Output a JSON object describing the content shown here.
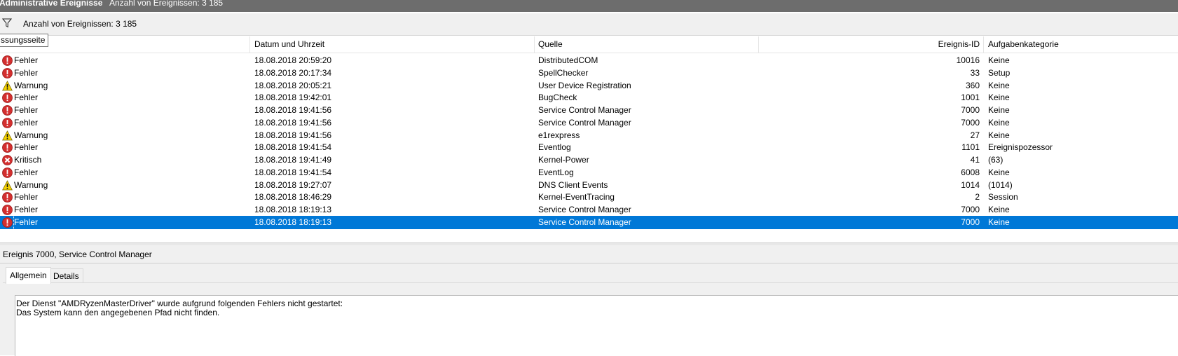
{
  "window": {
    "title": "Administrative Ereignisse",
    "count_text": "Anzahl von Ereignissen: 3 185"
  },
  "filterbar": {
    "icon": "filter-icon",
    "text": "Anzahl von Ereignissen: 3 185"
  },
  "tooltip": "ssungsseite",
  "columns": {
    "datetime": "Datum und Uhrzeit",
    "source": "Quelle",
    "event_id": "Ereignis-ID",
    "category": "Aufgabenkategorie"
  },
  "events": [
    {
      "level": "Fehler",
      "icon": "error-icon",
      "datetime": "18.08.2018 20:59:20",
      "source": "DistributedCOM",
      "id": "10016",
      "category": "Keine"
    },
    {
      "level": "Fehler",
      "icon": "error-icon",
      "datetime": "18.08.2018 20:17:34",
      "source": "SpellChecker",
      "id": "33",
      "category": "Setup"
    },
    {
      "level": "Warnung",
      "icon": "warning-icon",
      "datetime": "18.08.2018 20:05:21",
      "source": "User Device Registration",
      "id": "360",
      "category": "Keine"
    },
    {
      "level": "Fehler",
      "icon": "error-icon",
      "datetime": "18.08.2018 19:42:01",
      "source": "BugCheck",
      "id": "1001",
      "category": "Keine"
    },
    {
      "level": "Fehler",
      "icon": "error-icon",
      "datetime": "18.08.2018 19:41:56",
      "source": "Service Control Manager",
      "id": "7000",
      "category": "Keine"
    },
    {
      "level": "Fehler",
      "icon": "error-icon",
      "datetime": "18.08.2018 19:41:56",
      "source": "Service Control Manager",
      "id": "7000",
      "category": "Keine"
    },
    {
      "level": "Warnung",
      "icon": "warning-icon",
      "datetime": "18.08.2018 19:41:56",
      "source": "e1rexpress",
      "id": "27",
      "category": "Keine"
    },
    {
      "level": "Fehler",
      "icon": "error-icon",
      "datetime": "18.08.2018 19:41:54",
      "source": "Eventlog",
      "id": "1101",
      "category": "Ereignispozessor"
    },
    {
      "level": "Kritisch",
      "icon": "critical-icon",
      "datetime": "18.08.2018 19:41:49",
      "source": "Kernel-Power",
      "id": "41",
      "category": "(63)"
    },
    {
      "level": "Fehler",
      "icon": "error-icon",
      "datetime": "18.08.2018 19:41:54",
      "source": "EventLog",
      "id": "6008",
      "category": "Keine"
    },
    {
      "level": "Warnung",
      "icon": "warning-icon",
      "datetime": "18.08.2018 19:27:07",
      "source": "DNS Client Events",
      "id": "1014",
      "category": "(1014)"
    },
    {
      "level": "Fehler",
      "icon": "error-icon",
      "datetime": "18.08.2018 18:46:29",
      "source": "Kernel-EventTracing",
      "id": "2",
      "category": "Session"
    },
    {
      "level": "Fehler",
      "icon": "error-icon",
      "datetime": "18.08.2018 18:19:13",
      "source": "Service Control Manager",
      "id": "7000",
      "category": "Keine"
    },
    {
      "level": "Fehler",
      "icon": "error-icon",
      "datetime": "18.08.2018 18:19:13",
      "source": "Service Control Manager",
      "id": "7000",
      "category": "Keine",
      "selected": true
    }
  ],
  "detail": {
    "title": "Ereignis 7000, Service Control Manager",
    "tabs": [
      "Allgemein",
      "Details"
    ],
    "active_tab": "Allgemein",
    "message_lines": [
      "Der Dienst \"AMDRyzenMasterDriver\" wurde aufgrund folgenden Fehlers nicht gestartet:",
      "Das System kann den angegebenen Pfad nicht finden."
    ]
  },
  "colors": {
    "selection": "#0078d7",
    "error": "#d32f2f",
    "critical": "#d32f2f",
    "warning": "#f4d100"
  }
}
